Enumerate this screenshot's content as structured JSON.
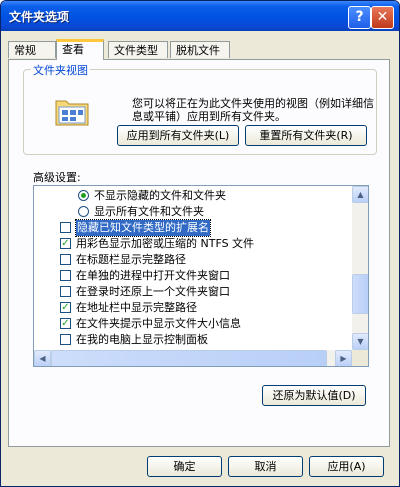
{
  "window": {
    "title": "文件夹选项",
    "help_glyph": "?",
    "close_glyph": "✕"
  },
  "tabs": [
    {
      "label": "常规"
    },
    {
      "label": "查看"
    },
    {
      "label": "文件类型"
    },
    {
      "label": "脱机文件"
    }
  ],
  "active_tab": "查看",
  "folder_views": {
    "legend": "文件夹视图",
    "description": "您可以将正在为此文件夹使用的视图（例如详细信息或平铺）应用到所有文件夹。",
    "apply_all_label": "应用到所有文件夹(L)",
    "reset_all_label": "重置所有文件夹(R)"
  },
  "advanced": {
    "label": "高级设置:",
    "items": [
      {
        "type": "radio",
        "checked": true,
        "label": "不显示隐藏的文件和文件夹"
      },
      {
        "type": "radio",
        "checked": false,
        "label": "显示所有文件和文件夹"
      },
      {
        "type": "checkbox",
        "checked": false,
        "label": "隐藏已知文件类型的扩展名",
        "selected": true
      },
      {
        "type": "checkbox",
        "checked": true,
        "label": "用彩色显示加密或压缩的 NTFS 文件"
      },
      {
        "type": "checkbox",
        "checked": false,
        "label": "在标题栏显示完整路径"
      },
      {
        "type": "checkbox",
        "checked": false,
        "label": "在单独的进程中打开文件夹窗口"
      },
      {
        "type": "checkbox",
        "checked": false,
        "label": "在登录时还原上一个文件夹窗口"
      },
      {
        "type": "checkbox",
        "checked": true,
        "label": "在地址栏中显示完整路径"
      },
      {
        "type": "checkbox",
        "checked": true,
        "label": "在文件夹提示中显示文件大小信息"
      },
      {
        "type": "checkbox",
        "checked": false,
        "label": "在我的电脑上显示控制面板"
      }
    ],
    "restore_defaults_label": "还原为默认值(D)"
  },
  "footer": {
    "ok_label": "确定",
    "cancel_label": "取消",
    "apply_label": "应用(A)"
  },
  "colors": {
    "titlebar": "#0054e3",
    "tab_highlight": "#ffc83c",
    "selection": "#316ac5",
    "check": "#21a121"
  }
}
